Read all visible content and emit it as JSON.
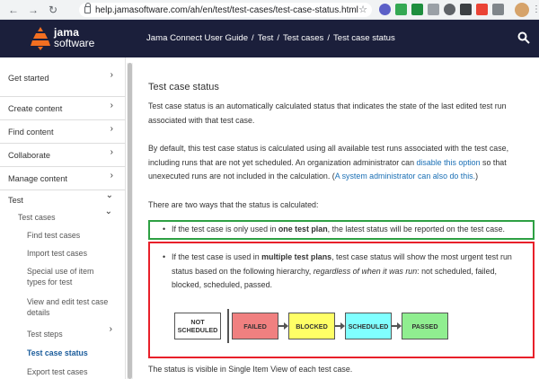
{
  "browser": {
    "url": "help.jamasoftware.com/ah/en/test/test-cases/test-case-status.html"
  },
  "header": {
    "logo_line1": "jama",
    "logo_line2": "software",
    "breadcrumbs": [
      "Jama Connect User Guide",
      "Test",
      "Test cases",
      "Test case status"
    ],
    "separator": "/"
  },
  "sidebar": {
    "items": [
      {
        "label": "Get started",
        "chevron": "›"
      },
      {
        "label": "Create content",
        "chevron": "›"
      },
      {
        "label": "Find content",
        "chevron": "›"
      },
      {
        "label": "Collaborate",
        "chevron": "›"
      },
      {
        "label": "Manage content",
        "chevron": "›"
      },
      {
        "label": "Test",
        "chevron": "⌄"
      }
    ],
    "sub_header": {
      "label": "Test cases",
      "chevron": "⌄"
    },
    "sub_items": [
      {
        "label": "Find test cases"
      },
      {
        "label": "Import test cases"
      },
      {
        "label": "Special use of item types for test"
      },
      {
        "label": "View and edit test case details"
      },
      {
        "label": "Test steps",
        "chevron": "›"
      },
      {
        "label": "Test case status"
      },
      {
        "label": "Export test cases"
      }
    ]
  },
  "content": {
    "title": "Test case status",
    "p1": "Test case status is an automatically calculated status that indicates the state of the last edited test run associated with that test case.",
    "p2_a": "By default, this test case status is calculated using all available test runs associated with the test case, including runs that are not yet scheduled. An organization administrator can ",
    "p2_link1": "disable this option",
    "p2_b": " so that unexecuted runs are not included in the calculation. (",
    "p2_link2": "A system administrator can also do this.",
    "p2_c": ")",
    "p3": "There are two ways that the status is calculated:",
    "bullet1_a": "If the test case is only used in ",
    "bullet1_bold": "one test plan",
    "bullet1_b": ", the latest status will be reported on the test case.",
    "bullet2_a": "If the test case is used in ",
    "bullet2_bold": "multiple test plans",
    "bullet2_b": ", test case status will show the most urgent test run status based on the following hierarchy, ",
    "bullet2_italic": "regardless of when it was run",
    "bullet2_c": ": not scheduled, failed, blocked, scheduled, passed.",
    "footer": "The status is visible in Single Item View of each test case."
  },
  "flow": {
    "states": [
      {
        "label": "NOT SCHEDULED",
        "color": "#ffffff"
      },
      {
        "label": "FAILED",
        "color": "#f08080"
      },
      {
        "label": "BLOCKED",
        "color": "#ffff66"
      },
      {
        "label": "SCHEDULED",
        "color": "#80ffff"
      },
      {
        "label": "PASSED",
        "color": "#90ee90"
      }
    ]
  },
  "colors": {
    "header_bg": "#1b1f3b",
    "link": "#1a6fb5",
    "green_box": "#2ea043",
    "red_box": "#e8202a"
  }
}
